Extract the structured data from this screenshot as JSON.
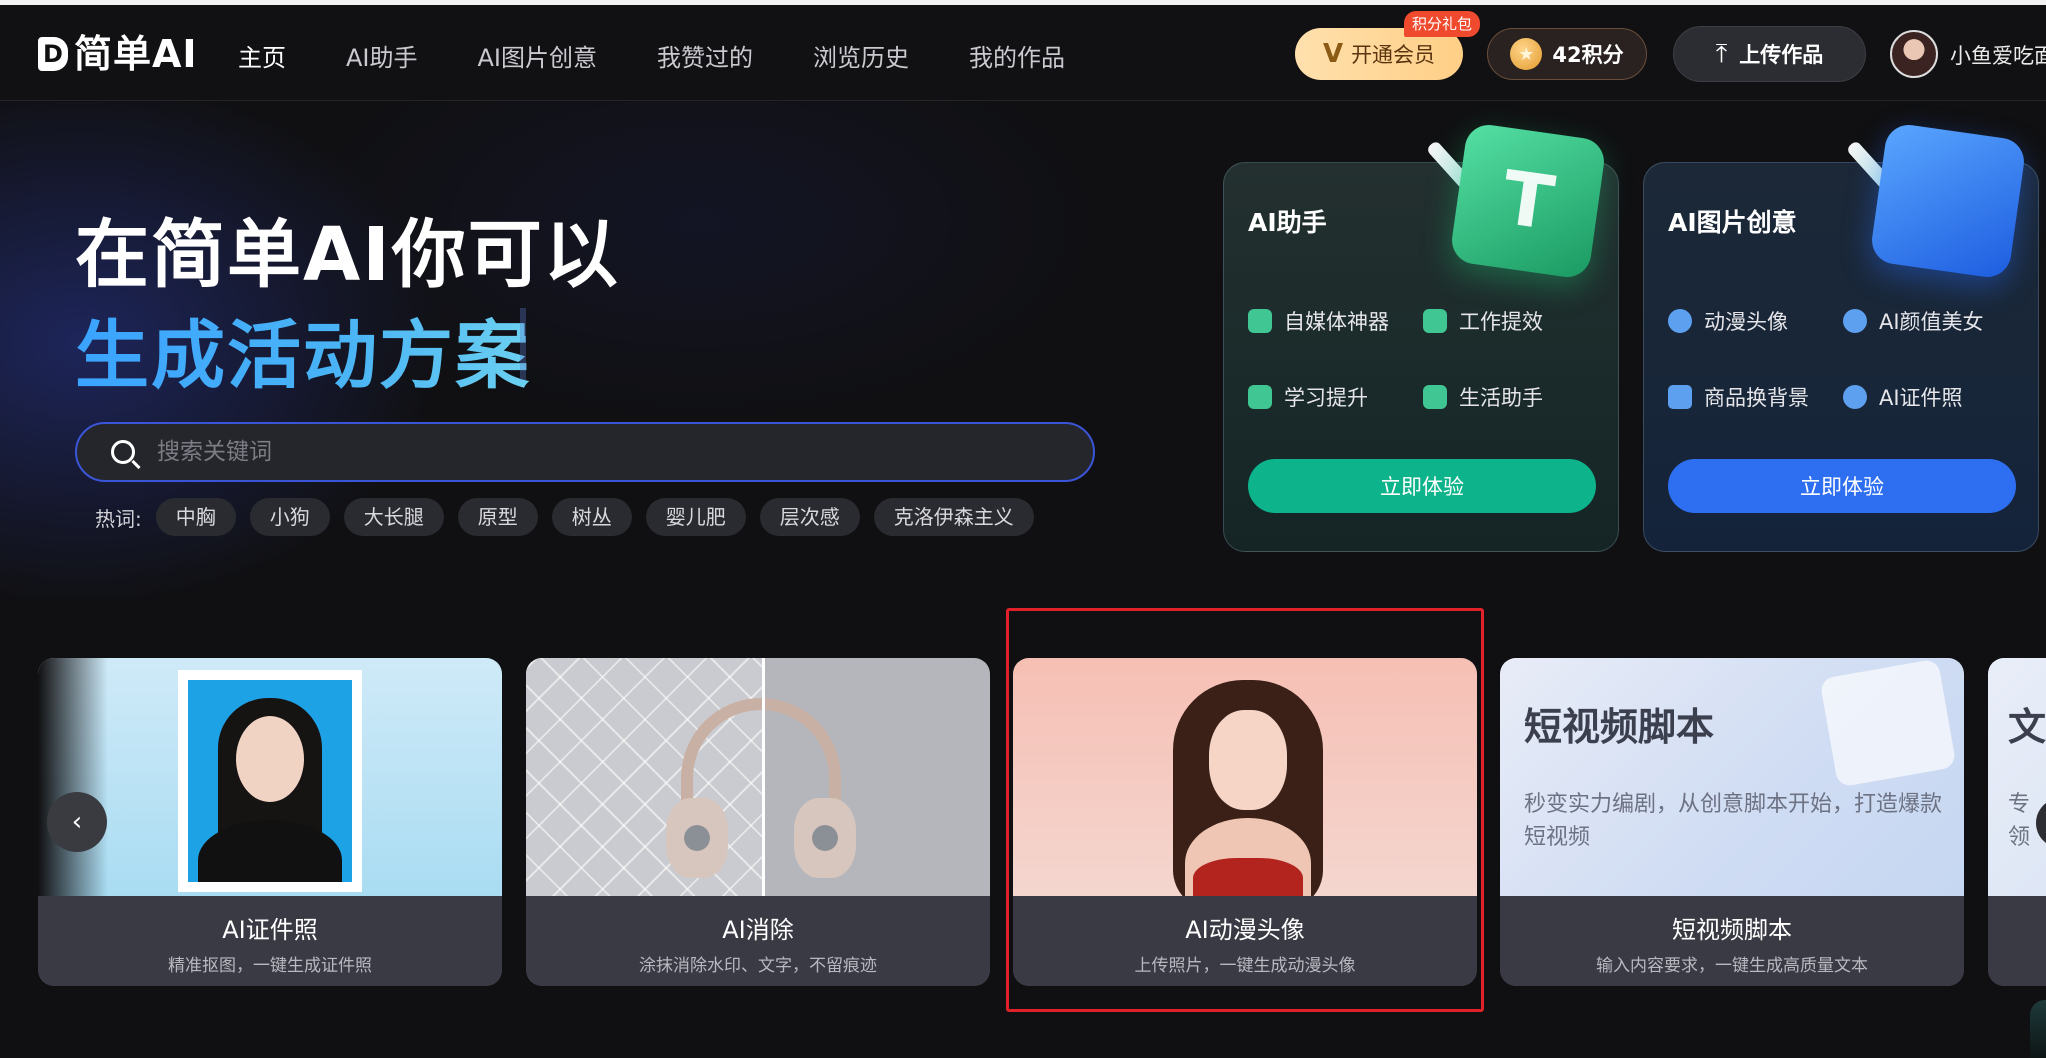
{
  "nav": {
    "logo_text": "简单AI",
    "logo_letter": "D",
    "items": [
      {
        "label": "主页",
        "active": true
      },
      {
        "label": "AI助手",
        "active": false
      },
      {
        "label": "AI图片创意",
        "active": false
      },
      {
        "label": "我赞过的",
        "active": false
      },
      {
        "label": "浏览历史",
        "active": false
      },
      {
        "label": "我的作品",
        "active": false
      }
    ],
    "vip_label": "开通会员",
    "vip_badge": "积分礼包",
    "points_label": "42积分",
    "upload_label": "上传作品",
    "username": "小鱼爱吃面"
  },
  "hero": {
    "title_line1": "在简单AI你可以",
    "title_line2": "生成活动方案",
    "search_placeholder": "搜索关键词",
    "hot_label": "热词:",
    "hot_tags": [
      "中胸",
      "小狗",
      "大长腿",
      "原型",
      "树丛",
      "婴儿肥",
      "层次感",
      "克洛伊森主义"
    ]
  },
  "feature_cards": [
    {
      "title": "AI助手",
      "art_glyph": "T",
      "items": [
        "自媒体神器",
        "工作提效",
        "学习提升",
        "生活助手"
      ],
      "button": "立即体验",
      "accent": "#0db38a"
    },
    {
      "title": "AI图片创意",
      "art_glyph": "",
      "items": [
        "动漫头像",
        "AI颜值美女",
        "商品换背景",
        "AI证件照"
      ],
      "button": "立即体验",
      "accent": "#2e6ff2"
    }
  ],
  "tools": [
    {
      "title": "AI证件照",
      "desc": "精准抠图，一键生成证件照"
    },
    {
      "title": "AI消除",
      "desc": "涂抹消除水印、文字，不留痕迹"
    },
    {
      "title": "AI动漫头像",
      "desc": "上传照片，一键生成动漫头像"
    },
    {
      "title": "短视频脚本",
      "desc": "输入内容要求，一键生成高质量文本",
      "cover_title": "短视频脚本",
      "cover_sub": "秒变实力编剧，从创意脚本开始，打造爆款短视频"
    },
    {
      "title": "",
      "desc": "",
      "cover_title": "文",
      "cover_sub": "专\n领"
    }
  ],
  "carousel": {
    "prev_icon": "‹"
  },
  "highlight_color": "#e0212a"
}
